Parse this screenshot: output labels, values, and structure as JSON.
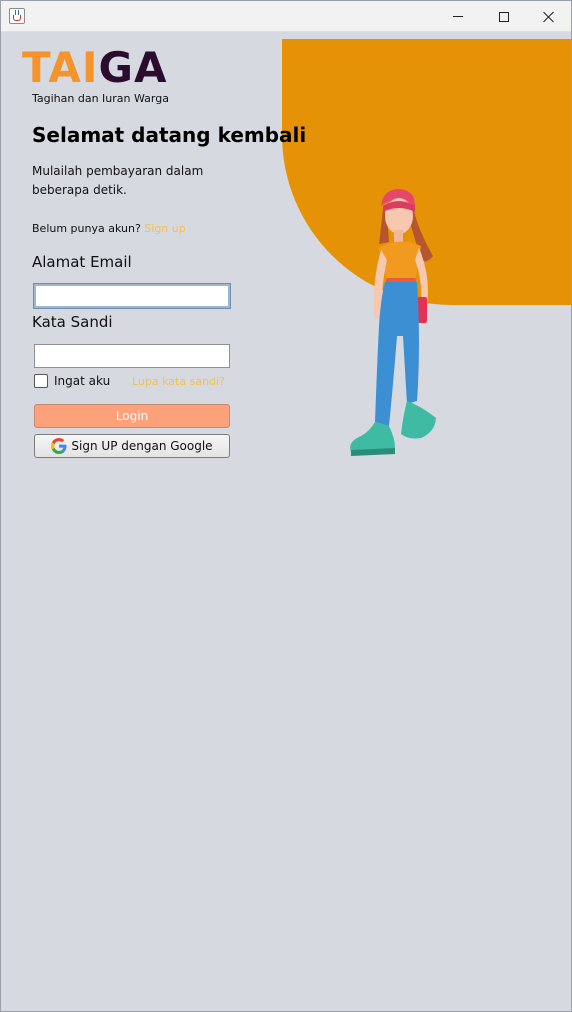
{
  "logo": {
    "part1": "TAI",
    "part2": "GA",
    "tagline": "Tagihan dan Iuran Warga"
  },
  "heading": "Selamat datang kembali",
  "subtitle": "Mulailah pembayaran dalam beberapa detik.",
  "signup": {
    "prompt": "Belum punya akun?",
    "link": "Sign up"
  },
  "email": {
    "label": "Alamat Email",
    "value": "",
    "placeholder": ""
  },
  "password": {
    "label": "Kata Sandi",
    "value": "",
    "placeholder": ""
  },
  "remember": {
    "label": "Ingat aku",
    "checked": false
  },
  "forgot": "Lupa kata sandi?",
  "login_button": "Login",
  "google_button": "Sign UP dengan Google",
  "colors": {
    "accent_orange": "#e69206",
    "logo_orange": "#f5942a",
    "logo_dark": "#2b0c2f",
    "link_yellow": "#f5c04a",
    "login_bg": "#fda17a",
    "background": "#d6d9e0"
  }
}
